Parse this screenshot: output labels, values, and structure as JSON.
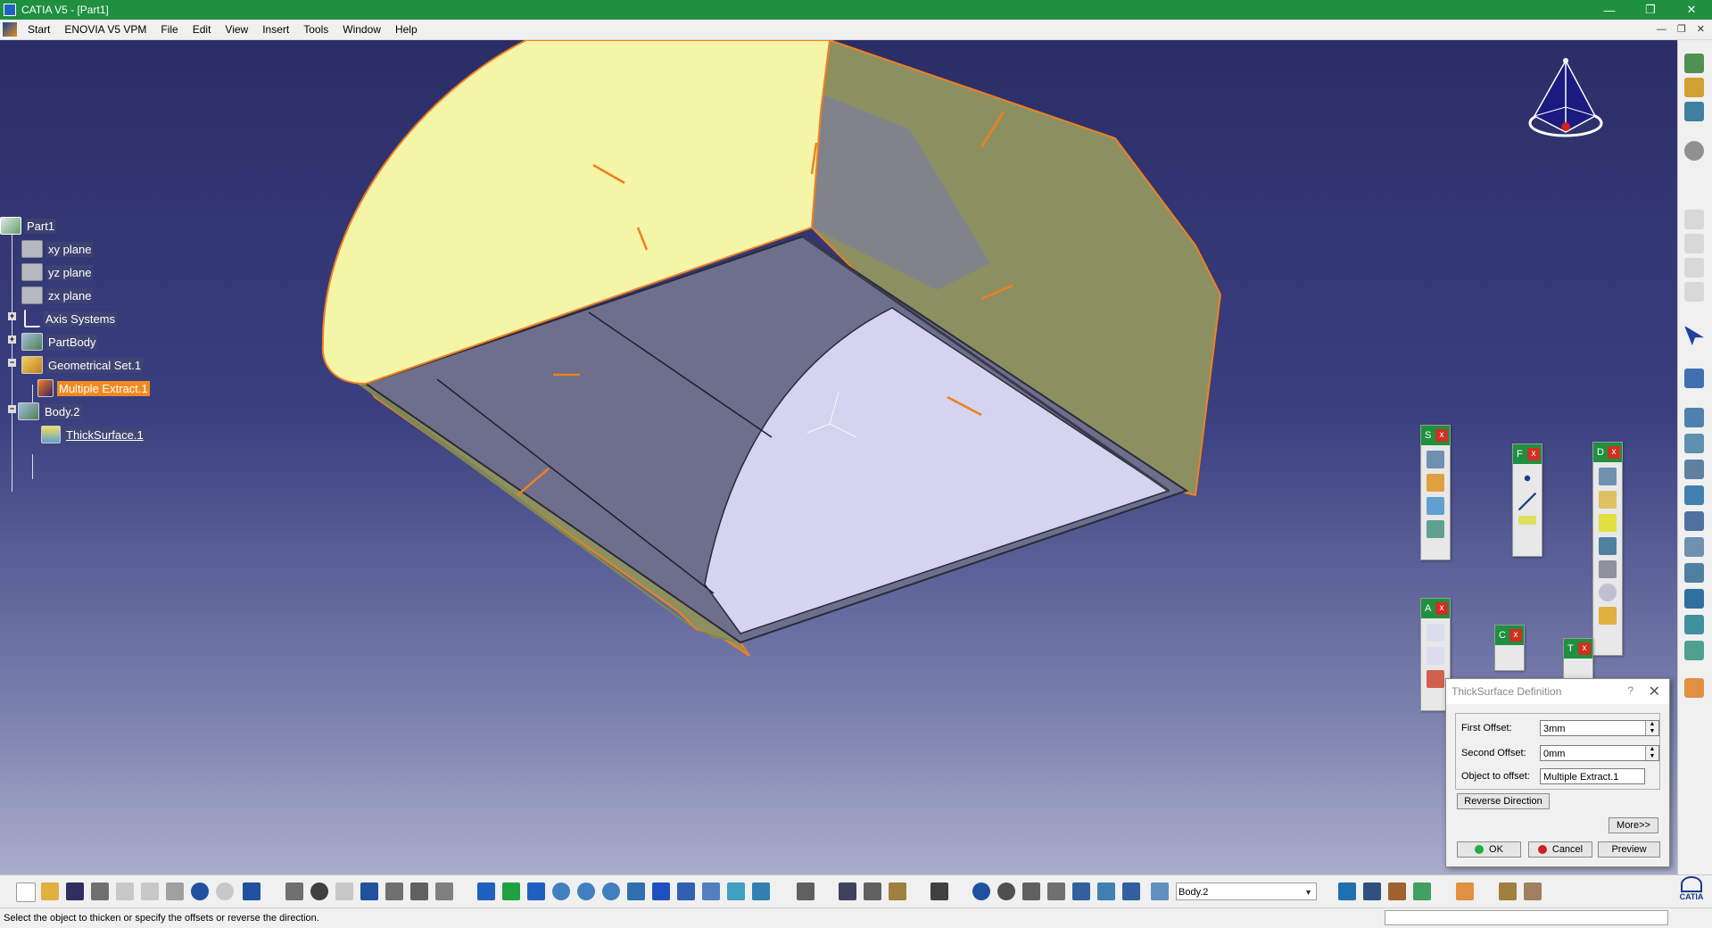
{
  "window": {
    "title": "CATIA V5 - [Part1]",
    "controls": [
      "—",
      "❐",
      "✕"
    ]
  },
  "menu": {
    "items": [
      {
        "label": "Start"
      },
      {
        "label": "ENOVIA V5 VPM"
      },
      {
        "label": "File"
      },
      {
        "label": "Edit"
      },
      {
        "label": "View"
      },
      {
        "label": "Insert"
      },
      {
        "label": "Tools"
      },
      {
        "label": "Window"
      },
      {
        "label": "Help"
      }
    ],
    "doc_controls": [
      "—",
      "❐",
      "✕"
    ]
  },
  "tree": {
    "nodes": [
      {
        "label": "Part1",
        "icon": "part-icon"
      },
      {
        "label": "xy plane",
        "icon": "plane-icon"
      },
      {
        "label": "yz plane",
        "icon": "plane-icon"
      },
      {
        "label": "zx plane",
        "icon": "plane-icon"
      },
      {
        "label": "Axis Systems",
        "icon": "axis-system-icon"
      },
      {
        "label": "PartBody",
        "icon": "body-icon"
      },
      {
        "label": "Geometrical Set.1",
        "icon": "geometrical-set-icon"
      },
      {
        "label": "Multiple Extract.1",
        "icon": "extract-icon"
      },
      {
        "label": "Body.2",
        "icon": "body-icon"
      },
      {
        "label": "ThickSurface.1",
        "icon": "thick-surface-icon"
      }
    ]
  },
  "floating_toolbars": {
    "surfaces": {
      "letter": "S"
    },
    "reference": {
      "letter": "F"
    },
    "dress_up": {
      "letter": "D"
    },
    "annotations": {
      "letter": "A"
    },
    "constraints": {
      "letter": "C"
    },
    "transform": {
      "letter": "T"
    },
    "close_glyph": "x"
  },
  "dialog": {
    "title": "ThickSurface Definition",
    "help_glyph": "?",
    "close_glyph": "✕",
    "first_offset_label": "First Offset:",
    "first_offset_value": "3mm",
    "second_offset_label": "Second Offset:",
    "second_offset_value": "0mm",
    "object_label": "Object to offset:",
    "object_value": "Multiple Extract.1",
    "reverse_label": "Reverse Direction",
    "more_label": "More>>",
    "ok_label": "OK",
    "cancel_label": "Cancel",
    "preview_label": "Preview"
  },
  "bottom_toolbar": {
    "current_body": "Body.2"
  },
  "status": {
    "text": "Select the object to thicken or specify the offsets or reverse the direction."
  },
  "brand": {
    "logo_text": "CATIA"
  },
  "colors": {
    "titlebar": "#1e9040",
    "selection": "#f08a20",
    "surface_yellow": "#f5f5a8",
    "surface_olive": "#8c9060",
    "surface_lavender": "#d4d4f0",
    "edge_orange": "#f08020"
  }
}
